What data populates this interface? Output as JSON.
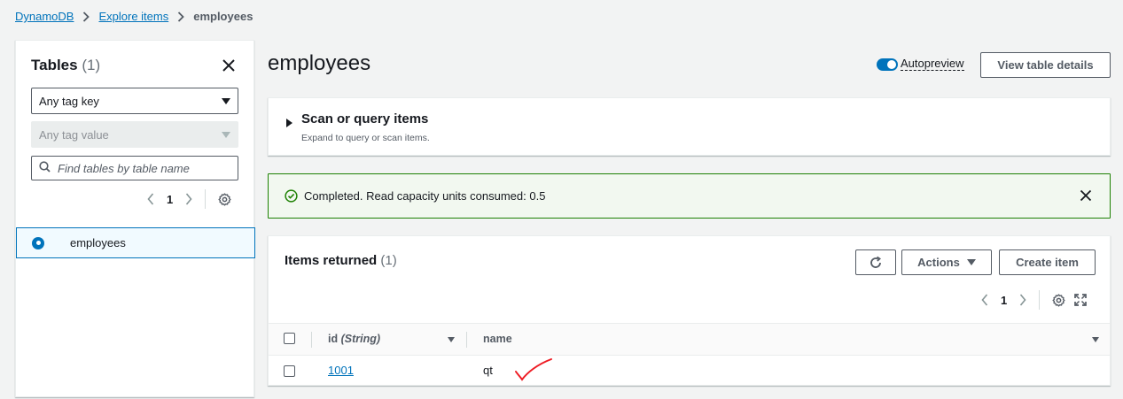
{
  "breadcrumb": {
    "items": [
      "DynamoDB",
      "Explore items"
    ],
    "current": "employees"
  },
  "left_panel": {
    "title": "Tables",
    "count": "(1)",
    "tag_key_select": "Any tag key",
    "tag_value_select": "Any tag value",
    "search_placeholder": "Find tables by table name",
    "page": "1",
    "tables": [
      {
        "name": "employees",
        "selected": true
      }
    ]
  },
  "main": {
    "title": "employees",
    "autopreview_label": "Autopreview",
    "autopreview_on": true,
    "view_details_label": "View table details",
    "scan": {
      "title": "Scan or query items",
      "subtitle": "Expand to query or scan items."
    },
    "alert": {
      "text": "Completed. Read capacity units consumed: 0.5"
    },
    "items": {
      "title": "Items returned",
      "count": "(1)",
      "actions_label": "Actions",
      "create_label": "Create item",
      "page": "1",
      "columns": [
        {
          "label": "id",
          "type": "(String)"
        },
        {
          "label": "name"
        }
      ],
      "rows": [
        {
          "id": "1001",
          "name": "qt"
        }
      ]
    }
  },
  "colors": {
    "link": "#0073bb",
    "success": "#1d8102",
    "annotation": "#ee1c24"
  }
}
